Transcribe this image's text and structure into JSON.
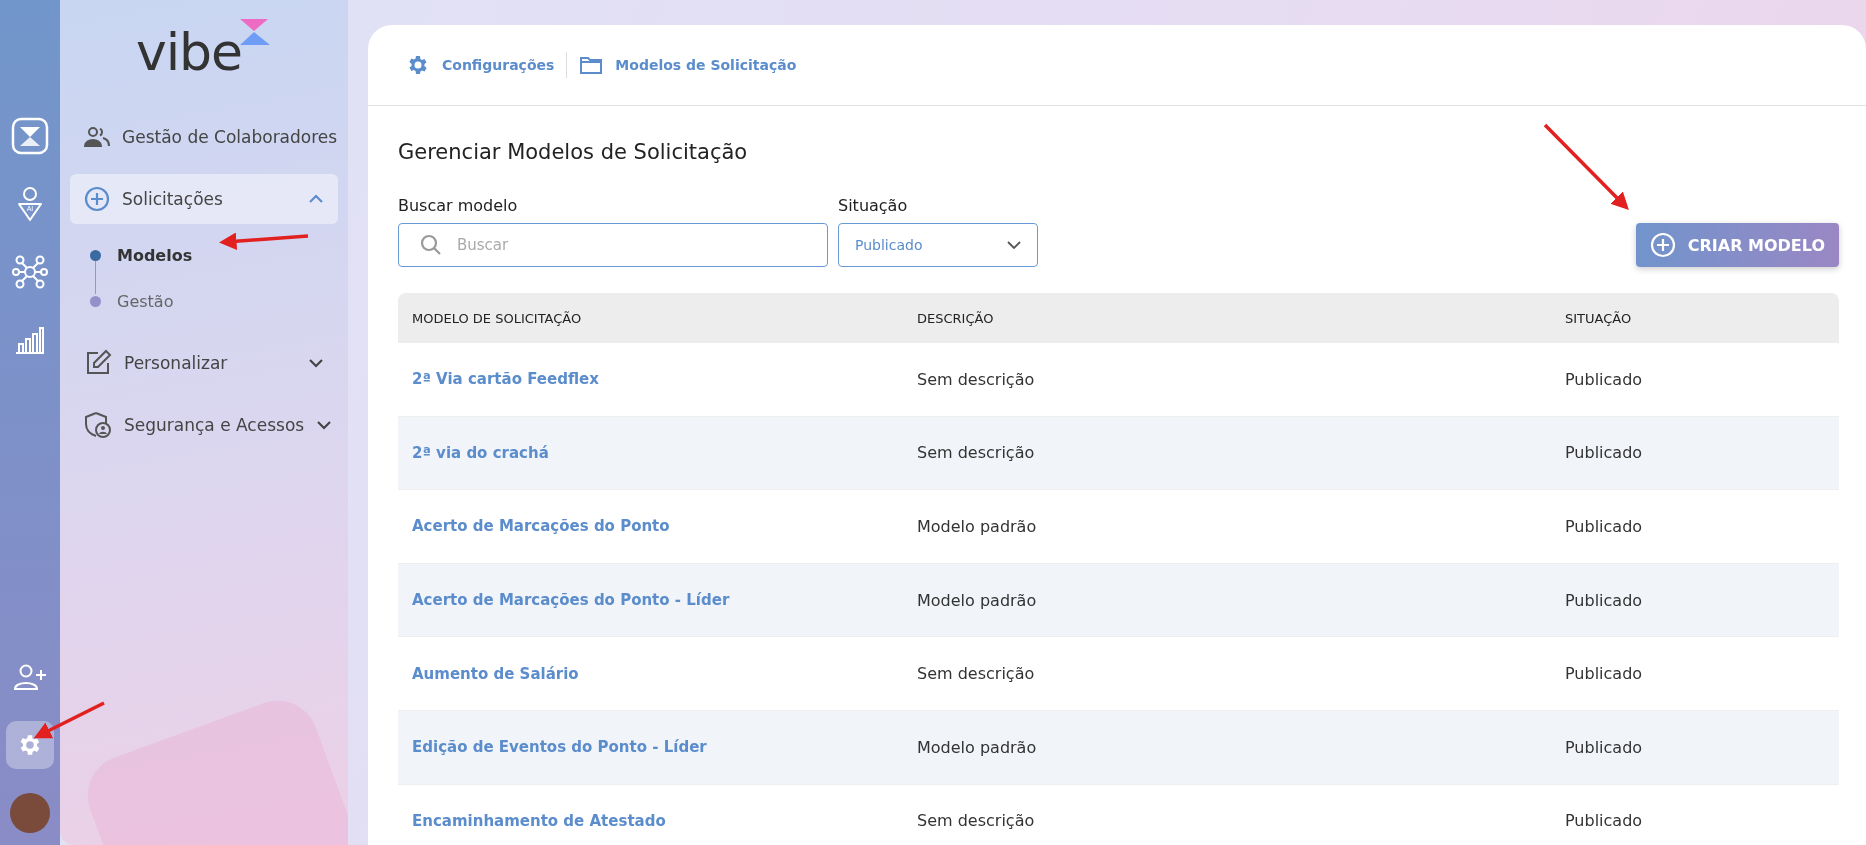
{
  "brand": {
    "name": "vibe"
  },
  "rail": [
    {
      "kind": "logo",
      "selected": false
    },
    {
      "kind": "ai",
      "label": "AI",
      "selected": false
    },
    {
      "kind": "network",
      "selected": false
    },
    {
      "kind": "chart",
      "selected": false
    },
    {
      "kind": "add-user",
      "selected": false
    },
    {
      "kind": "gear",
      "selected": true
    },
    {
      "kind": "avatar",
      "selected": false
    }
  ],
  "sidebar": {
    "items": [
      {
        "label": "Gestão de Colaboradores",
        "kind": "people"
      },
      {
        "label": "Solicitações",
        "kind": "plus",
        "expanded": true,
        "children": [
          {
            "label": "Modelos",
            "selected": true
          },
          {
            "label": "Gestão",
            "selected": false
          }
        ]
      },
      {
        "label": "Personalizar",
        "kind": "edit",
        "expanded": false
      },
      {
        "label": "Segurança e Acessos",
        "kind": "shield",
        "expanded": false
      }
    ]
  },
  "breadcrumb": [
    {
      "label": "Configurações",
      "kind": "gear"
    },
    {
      "label": "Modelos de Solicitação",
      "kind": "folder"
    }
  ],
  "page_title": "Gerenciar Modelos de Solicitação",
  "search": {
    "label": "Buscar modelo",
    "placeholder": "Buscar"
  },
  "status_filter": {
    "label": "Situação",
    "value": "Publicado"
  },
  "create_button": "CRIAR MODELO",
  "table": {
    "columns": [
      "MODELO DE SOLICITAÇÃO",
      "DESCRIÇÃO",
      "SITUAÇÃO"
    ],
    "rows": [
      {
        "model": "2ª Via cartão Feedflex",
        "description": "Sem descrição",
        "status": "Publicado"
      },
      {
        "model": "2ª via do crachá",
        "description": "Sem descrição",
        "status": "Publicado"
      },
      {
        "model": "Acerto de Marcações do Ponto",
        "description": "Modelo padrão",
        "status": "Publicado"
      },
      {
        "model": "Acerto de Marcações do Ponto - Líder",
        "description": "Modelo padrão",
        "status": "Publicado"
      },
      {
        "model": "Aumento de Salário",
        "description": "Sem descrição",
        "status": "Publicado"
      },
      {
        "model": "Edição de Eventos do Ponto - Líder",
        "description": "Modelo padrão",
        "status": "Publicado"
      },
      {
        "model": "Encaminhamento de Atestado",
        "description": "Sem descrição",
        "status": "Publicado"
      }
    ]
  }
}
